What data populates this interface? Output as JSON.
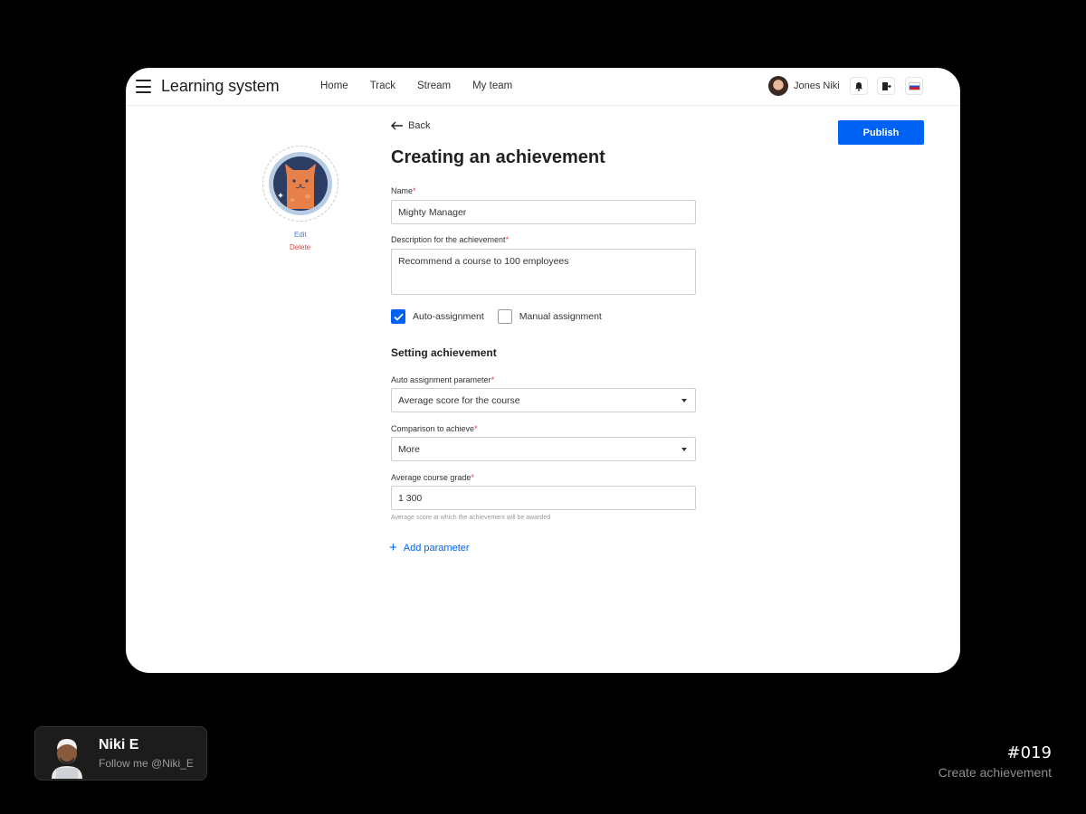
{
  "header": {
    "title": "Learning system",
    "nav": [
      "Home",
      "Track",
      "Stream",
      "My team"
    ],
    "user_name": "Jones Niki"
  },
  "badge": {
    "edit_label": "Edit",
    "delete_label": "Delete"
  },
  "form": {
    "back_label": "Back",
    "publish_label": "Publish",
    "page_title": "Creating an achievement",
    "name_label": "Name",
    "name_value": "Mighty Manager",
    "description_label": "Description for the achievement",
    "description_value": "Recommend a course to 100 employees",
    "auto_assign_label": "Auto-assignment",
    "auto_assign_checked": true,
    "manual_assign_label": "Manual assignment",
    "manual_assign_checked": false,
    "section_title": "Setting achievement",
    "param_label": "Auto assignment parameter",
    "param_value": "Average score for the course",
    "comparison_label": "Comparison to achieve",
    "comparison_value": "More",
    "grade_label": "Average course grade",
    "grade_value": "1 300",
    "grade_helper": "Average score at which the achievement will be awarded",
    "add_param_label": "Add parameter",
    "required_mark": "*"
  },
  "profile": {
    "name": "Niki E",
    "subtitle": "Follow me @Niki_E"
  },
  "shot": {
    "number": "#019",
    "title": "Create achievement"
  },
  "colors": {
    "accent": "#0061f5",
    "danger": "#e53e3e",
    "link": "#3b82f6"
  }
}
